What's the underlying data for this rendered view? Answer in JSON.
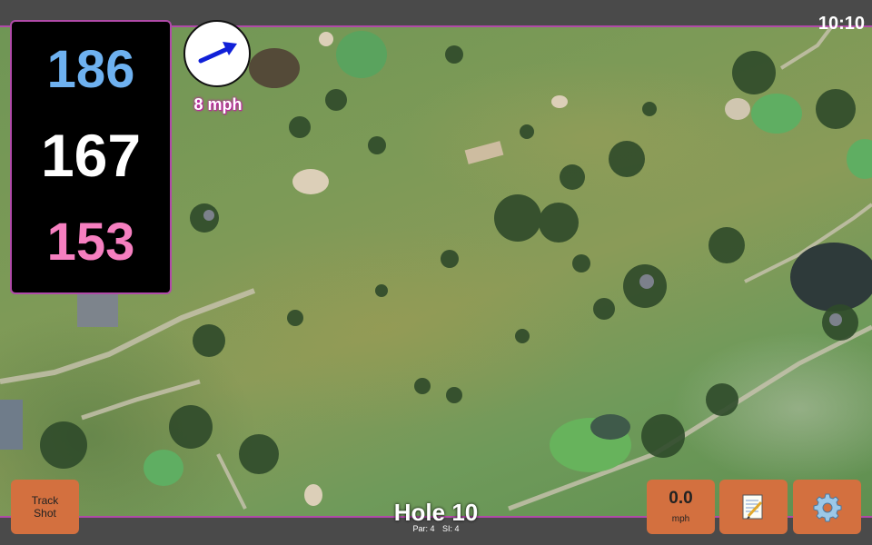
{
  "status_bar": {
    "clock": "10:10"
  },
  "distances": {
    "back": "186",
    "middle": "167",
    "front": "153"
  },
  "wind": {
    "speed": "8 mph",
    "direction": "east-northeast"
  },
  "buttons": {
    "track_shot_line1": "Track",
    "track_shot_line2": "Shot",
    "speed_value": "0.0",
    "speed_unit": "mph",
    "notes_icon": "notepad-icon",
    "settings_icon": "gear-icon"
  },
  "hole": {
    "title": "Hole 10",
    "par": "Par: 4",
    "si": "SI: 4"
  },
  "colors": {
    "back": "#6eb1f0",
    "middle": "#ffffff",
    "front": "#f67fc0",
    "button": "#d3703f",
    "accent": "#b04aa8"
  }
}
